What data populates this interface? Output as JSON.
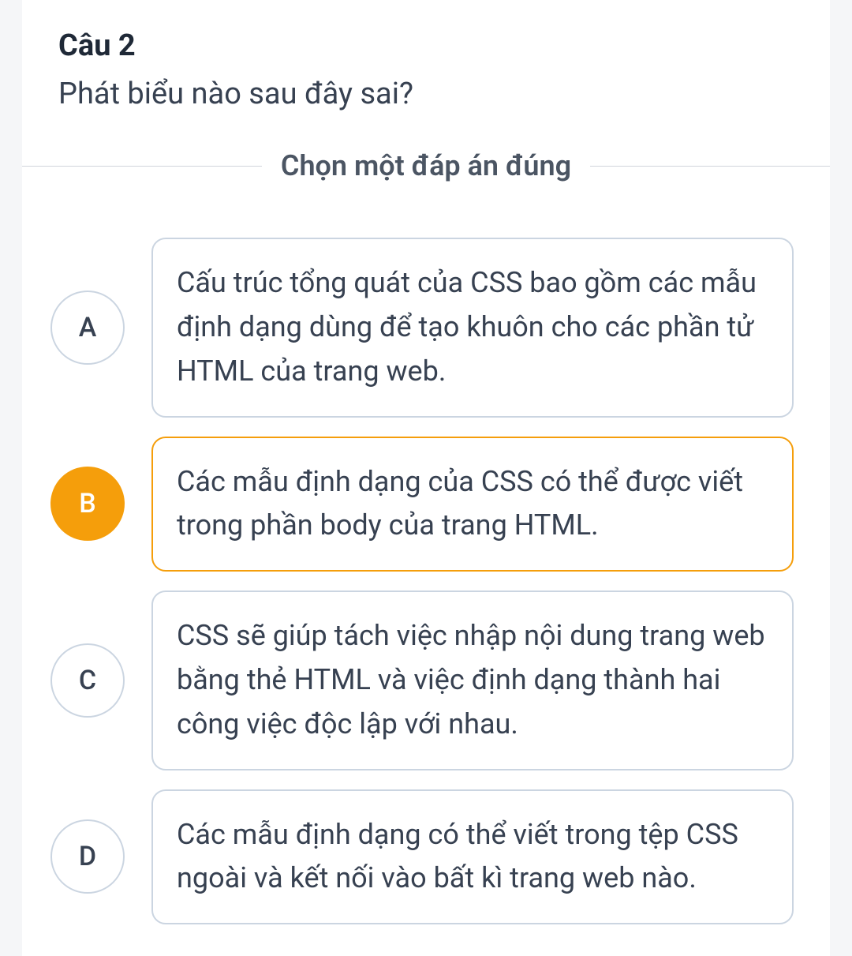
{
  "question": {
    "number": "Câu 2",
    "text": "Phát biểu nào sau đây sai?"
  },
  "instruction": "Chọn một đáp án đúng",
  "options": [
    {
      "letter": "A",
      "text": "Cấu trúc tổng quát của CSS bao gồm các mẫu định dạng dùng để tạo khuôn cho các phần tử HTML của trang web.",
      "selected": false
    },
    {
      "letter": "B",
      "text": "Các mẫu định dạng của CSS có thể được viết trong phần body của trang HTML.",
      "selected": true
    },
    {
      "letter": "C",
      "text": "CSS sẽ giúp tách việc nhập nội dung trang web bằng thẻ HTML và việc định dạng thành hai công việc độc lập với nhau.",
      "selected": false
    },
    {
      "letter": "D",
      "text": "Các mẫu định dạng có thể viết trong tệp CSS ngoài và kết nối vào bất kì trang web nào.",
      "selected": false
    }
  ]
}
